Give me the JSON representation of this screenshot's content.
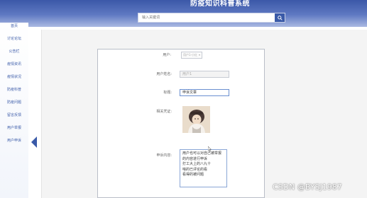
{
  "app": {
    "title": "防疫知识科普系统"
  },
  "search": {
    "placeholder": "输入关键词"
  },
  "sidebar": {
    "items": [
      {
        "label": "首页"
      },
      {
        "label": "讨论论坛"
      },
      {
        "label": "公告栏"
      },
      {
        "label": "疫情资讯"
      },
      {
        "label": "疫情状况"
      },
      {
        "label": "防疫科普"
      },
      {
        "label": "防疫问题"
      },
      {
        "label": "留言反馈"
      },
      {
        "label": "用户举报"
      },
      {
        "label": "用户申诉"
      }
    ],
    "active_index": 9
  },
  "form": {
    "user_label": "用户:",
    "user_select_value": "用户1-小红",
    "username_label": "用户姓名:",
    "username_value": "用户1",
    "title_label": "标题:",
    "title_value": "申诉文章",
    "evidence_label": "相关凭证:",
    "content_label": "申诉内容:",
    "content_value": "用户也可以对自己被举报\n的内容进行申诉\n打工大上的八九十\n啥的已评论的看\n看得的被问题"
  },
  "watermark": "CSDN @BYSJ1987",
  "colors": {
    "accent": "#3a5aa8",
    "header_top": "#3b58a8",
    "header_bottom": "#aab9e2"
  }
}
